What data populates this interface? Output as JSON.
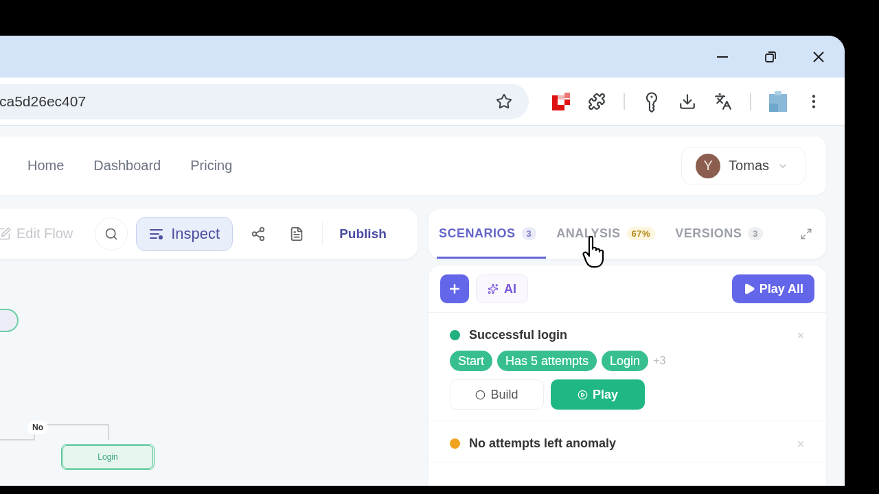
{
  "browser": {
    "url": "ca5d26ec407"
  },
  "nav": {
    "links": [
      {
        "label": "Home"
      },
      {
        "label": "Dashboard"
      },
      {
        "label": "Pricing"
      }
    ],
    "user": {
      "initial": "Y",
      "name": "Tomas"
    }
  },
  "flow_toolbar": {
    "edit": {
      "label": "Edit Flow",
      "disabled": true
    },
    "inspect": {
      "label": "Inspect",
      "selected": true
    },
    "publish": "Publish"
  },
  "canvas": {
    "edge_label": "No",
    "nodes": [
      {
        "kind": "clipped"
      },
      {
        "kind": "action",
        "label": "Login"
      }
    ]
  },
  "panel": {
    "tabs": [
      {
        "label": "SCENARIOS",
        "badge": "3",
        "kind": "count",
        "selected": true
      },
      {
        "label": "ANALYSIS",
        "badge": "67%",
        "kind": "score",
        "selected": false
      },
      {
        "label": "VERSIONS",
        "badge": "3",
        "kind": "count",
        "selected": false
      }
    ],
    "toolbar": {
      "ai": "AI",
      "play_all": "Play All"
    },
    "scenarios": [
      {
        "title": "Successful login",
        "color": "#22b07d",
        "tags": [
          "Start",
          "Has 5 attempts",
          "Login"
        ],
        "more": "+3",
        "actions": [
          {
            "label": "Build",
            "kind": "outline"
          },
          {
            "label": "Play",
            "kind": "primary"
          }
        ]
      },
      {
        "title": "No attempts left anomaly",
        "color": "#f0a31f"
      }
    ]
  }
}
